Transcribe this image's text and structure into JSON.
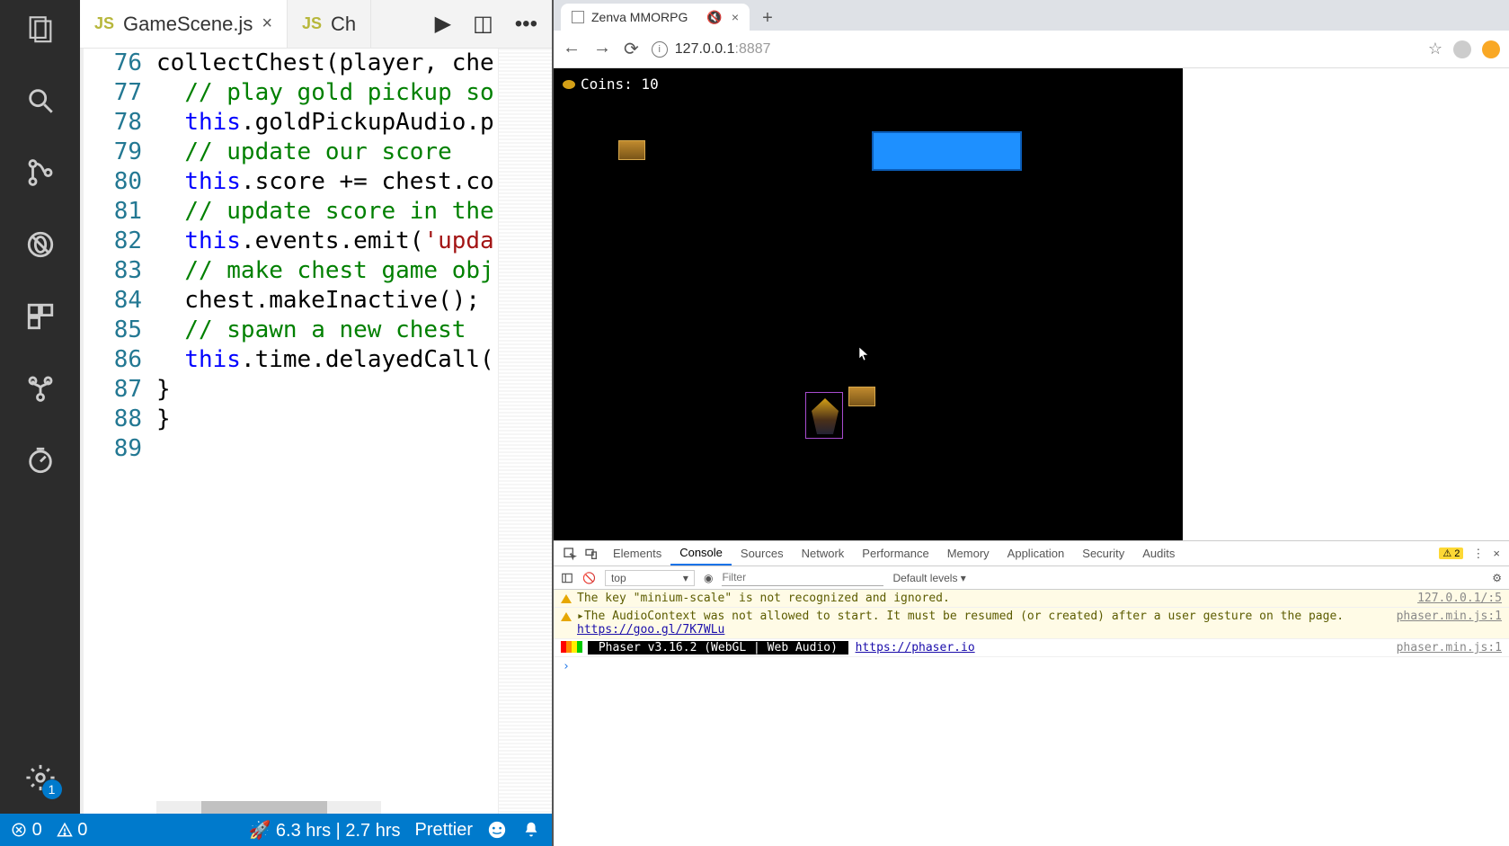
{
  "editor": {
    "tabs": [
      {
        "icon": "JS",
        "label": "GameScene.js",
        "active": true
      },
      {
        "icon": "JS",
        "label": "Ch",
        "active": false
      }
    ],
    "actions": {
      "run_label": "▶",
      "split_label": "◫",
      "more_label": "•••"
    },
    "line_start": 76,
    "lines": [
      {
        "n": 76,
        "html": "collectChest(player, che"
      },
      {
        "n": 77,
        "html": "  <span class='c-comment'>// play gold pickup so</span>"
      },
      {
        "n": 78,
        "html": "  <span class='c-this'>this</span>.goldPickupAudio.p"
      },
      {
        "n": 79,
        "html": "  <span class='c-comment'>// update our score</span>"
      },
      {
        "n": 80,
        "html": "  <span class='c-this'>this</span>.score += chest.co"
      },
      {
        "n": 81,
        "html": "  <span class='c-comment'>// update score in the</span>"
      },
      {
        "n": 82,
        "html": "  <span class='c-this'>this</span>.events.emit(<span class='c-string'>'upda</span>"
      },
      {
        "n": 83,
        "html": "  <span class='c-comment'>// make chest game obj</span>"
      },
      {
        "n": 84,
        "html": "  chest.makeInactive();"
      },
      {
        "n": 85,
        "html": "  <span class='c-comment'>// spawn a new chest</span>"
      },
      {
        "n": 86,
        "html": "  <span class='c-this'>this</span>.time.delayedCall("
      },
      {
        "n": 87,
        "html": "}"
      },
      {
        "n": 88,
        "html": "}"
      },
      {
        "n": 89,
        "html": ""
      }
    ]
  },
  "status_bar": {
    "errors": "0",
    "warnings": "0",
    "time": "🚀 6.3 hrs | 2.7 hrs",
    "formatter": "Prettier",
    "settings_badge": "1"
  },
  "browser": {
    "tab_title": "Zenva MMORPG",
    "url_ip": "127.0.0.1",
    "url_port": ":8887"
  },
  "game": {
    "coins_label": "Coins: 10"
  },
  "devtools": {
    "tabs": [
      "Elements",
      "Console",
      "Sources",
      "Network",
      "Performance",
      "Memory",
      "Application",
      "Security",
      "Audits"
    ],
    "active_tab_index": 1,
    "warn_count": "2",
    "context": "top",
    "filter_placeholder": "Filter",
    "levels": "Default levels ▾",
    "console": [
      {
        "type": "warn",
        "msg": "The key \"minium-scale\" is not recognized and ignored.",
        "src": "127.0.0.1/:5"
      },
      {
        "type": "warn",
        "msg_pre": "▸The AudioContext was not allowed to start. It must be resumed (or created) after a user gesture on the page. ",
        "link": "https://goo.gl/7K7WLu",
        "src": "phaser.min.js:1"
      },
      {
        "type": "info",
        "phaser_tag": " Phaser v3.16.2 (WebGL | Web Audio) ",
        "link": "https://phaser.io",
        "src": "phaser.min.js:1"
      }
    ],
    "prompt": "›"
  }
}
